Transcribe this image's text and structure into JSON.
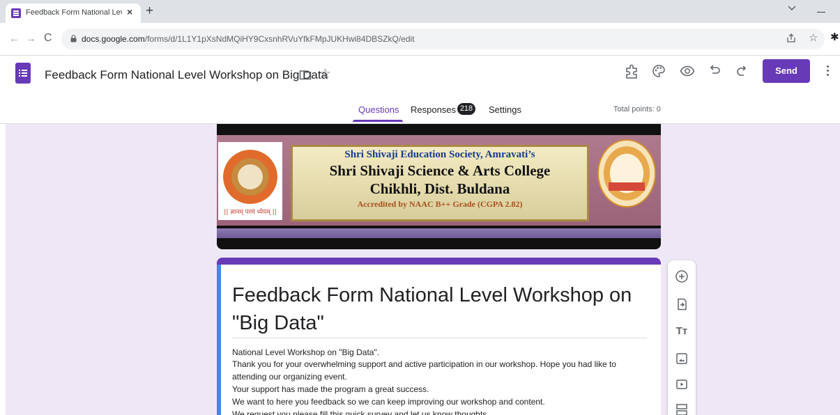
{
  "browser": {
    "tab_title": "Feedback Form National Level W",
    "tab_close": "×",
    "new_tab": "+",
    "url_host": "docs.google.com",
    "url_path": "/forms/d/1L1Y1pXsNdMQiHY9CxsnhRVuYfkFMpJUKHwi84DBSZkQ/edit",
    "back_glyph": "←",
    "forward_glyph": "→",
    "reload_glyph": "C",
    "star_glyph": "☆",
    "extension_glyph": "✱"
  },
  "header": {
    "title": "Feedback Form National Level Workshop on Big Data",
    "star_glyph": "☆",
    "send_label": "Send",
    "icons": [
      "customize-theme-icon",
      "palette-icon",
      "preview-eye-icon",
      "undo-icon",
      "redo-icon",
      "more-vert-icon"
    ]
  },
  "tabs": {
    "questions": "Questions",
    "responses": "Responses",
    "responses_count": "218",
    "settings": "Settings",
    "total_points": "Total points: 0"
  },
  "banner": {
    "line1": "Shri Shivaji Education Society, Amravati’s",
    "line2": "Shri Shivaji Science & Arts College",
    "line3": "Chikhli, Dist. Buldana",
    "line4": "Accredited by NAAC B++ Grade (CGPA 2.82)",
    "left_emblem_text": "|| ज्ञानम् परमं ध्येयम् ||"
  },
  "form": {
    "title": "Feedback Form National Level Workshop on \"Big Data\"",
    "description": [
      "National Level Workshop on \"Big Data\".",
      "Thank you for your overwhelming support and active participation in our workshop. Hope you had like to",
      "attending our organizing event.",
      "Your support has made the program a great success.",
      "We want to here you feedback so we can keep improving our workshop and content.",
      "We request you please fill this quick survey and let us know thoughts."
    ]
  },
  "toolbar": {
    "tools": [
      "add-question-icon",
      "import-questions-icon",
      "add-title-icon",
      "add-image-icon",
      "add-video-icon",
      "add-section-icon"
    ],
    "title_glyph": "Tт"
  },
  "colors": {
    "brand": "#673ab7",
    "canvas": "#ede7f6",
    "accent_blue": "#4285f4"
  }
}
